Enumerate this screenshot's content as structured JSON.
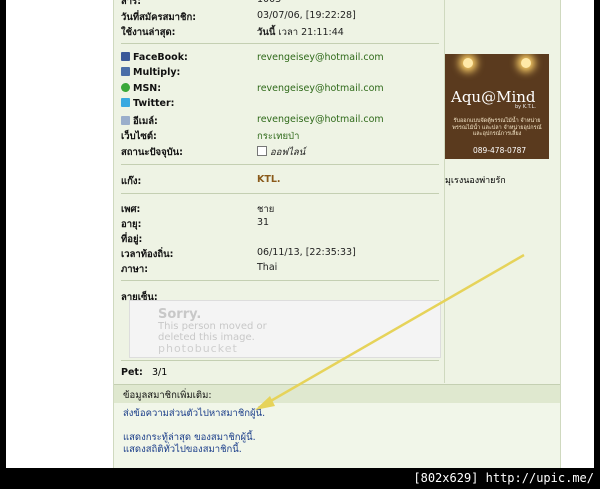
{
  "profile": {
    "top_cut_value": "1003",
    "joined": {
      "label": "วันที่สมัครสมาชิก:",
      "value": "03/07/06, [19:22:28]"
    },
    "last_active": {
      "label": "ใช้งานล่าสุด:",
      "day_word": "วันนี้",
      "value": "เวลา 21:11:44"
    },
    "contacts": [
      {
        "icon": "facebook-icon",
        "color": "#3b5998",
        "label": "FaceBook:",
        "value": "revengeisey@hotmail.com"
      },
      {
        "icon": "multiply-icon",
        "color": "#4a6ea8",
        "label": "Multiply:",
        "value": ""
      },
      {
        "icon": "msn-icon",
        "color": "#3aa83a",
        "label": "MSN:",
        "value": "revengeisey@hotmail.com"
      },
      {
        "icon": "twitter-icon",
        "color": "#39a9e0",
        "label": "Twitter:",
        "value": ""
      },
      {
        "icon": "email-icon",
        "color": "#9aaecb",
        "label": "อีเมล์:",
        "value": "revengeisey@hotmail.com"
      }
    ],
    "website": {
      "label": "เว็บไซต์:",
      "value": "กระเทยป่า"
    },
    "status": {
      "label": "สถานะปัจจุบัน:",
      "value": "ออฟไลน์"
    },
    "gang": {
      "label": "แก๊ง:",
      "value": "KTL."
    },
    "gender": {
      "label": "เพศ:",
      "value": "ชาย"
    },
    "age": {
      "label": "อายุ:",
      "value": "31"
    },
    "address": {
      "label": "ที่อยู่:",
      "value": ""
    },
    "local_time": {
      "label": "เวลาท้องถิ่น:",
      "value": "06/11/13, [22:35:33]"
    },
    "language": {
      "label": "ภาษา:",
      "value": "Thai"
    },
    "signature_label": "ลายเซ็น:",
    "signature_image": {
      "line1": "Sorry.",
      "line2": "This person moved or",
      "line3": "deleted this image.",
      "brand": "photobucket"
    },
    "pet": {
      "label": "Pet:",
      "value": "3/1"
    }
  },
  "ad": {
    "title": "Aqu@Mind",
    "byline": "by K.T.L.",
    "tagline": "รับออกแบบจัดตู้พรรณไม้น้ำ จำหน่าย พรรณไม้น้ำ และปลา จำหน่ายอุปกรณ์และอุปกรณ์การเลี้ยง",
    "phone": "089-478-0787",
    "caption": "มุเรงนองพ่ายรัก"
  },
  "extra": {
    "header": "ข้อมูลสมาชิกเพิ่มเติม:",
    "links": [
      "ส่งข้อความส่วนตัวไปหาสมาชิกผู้นี้.",
      "แสดงกระทู้ล่าสุด ของสมาชิกผู้นี้.",
      "แสดงสถิติทั่วไปของสมาชิกนี้."
    ]
  },
  "watermark": "[802x629] http://upic.me/",
  "colors": {
    "arrow": "#e6d35a",
    "link": "#1b3e8a",
    "value_green": "#2f6a1a",
    "panel": "#eef3e4"
  }
}
